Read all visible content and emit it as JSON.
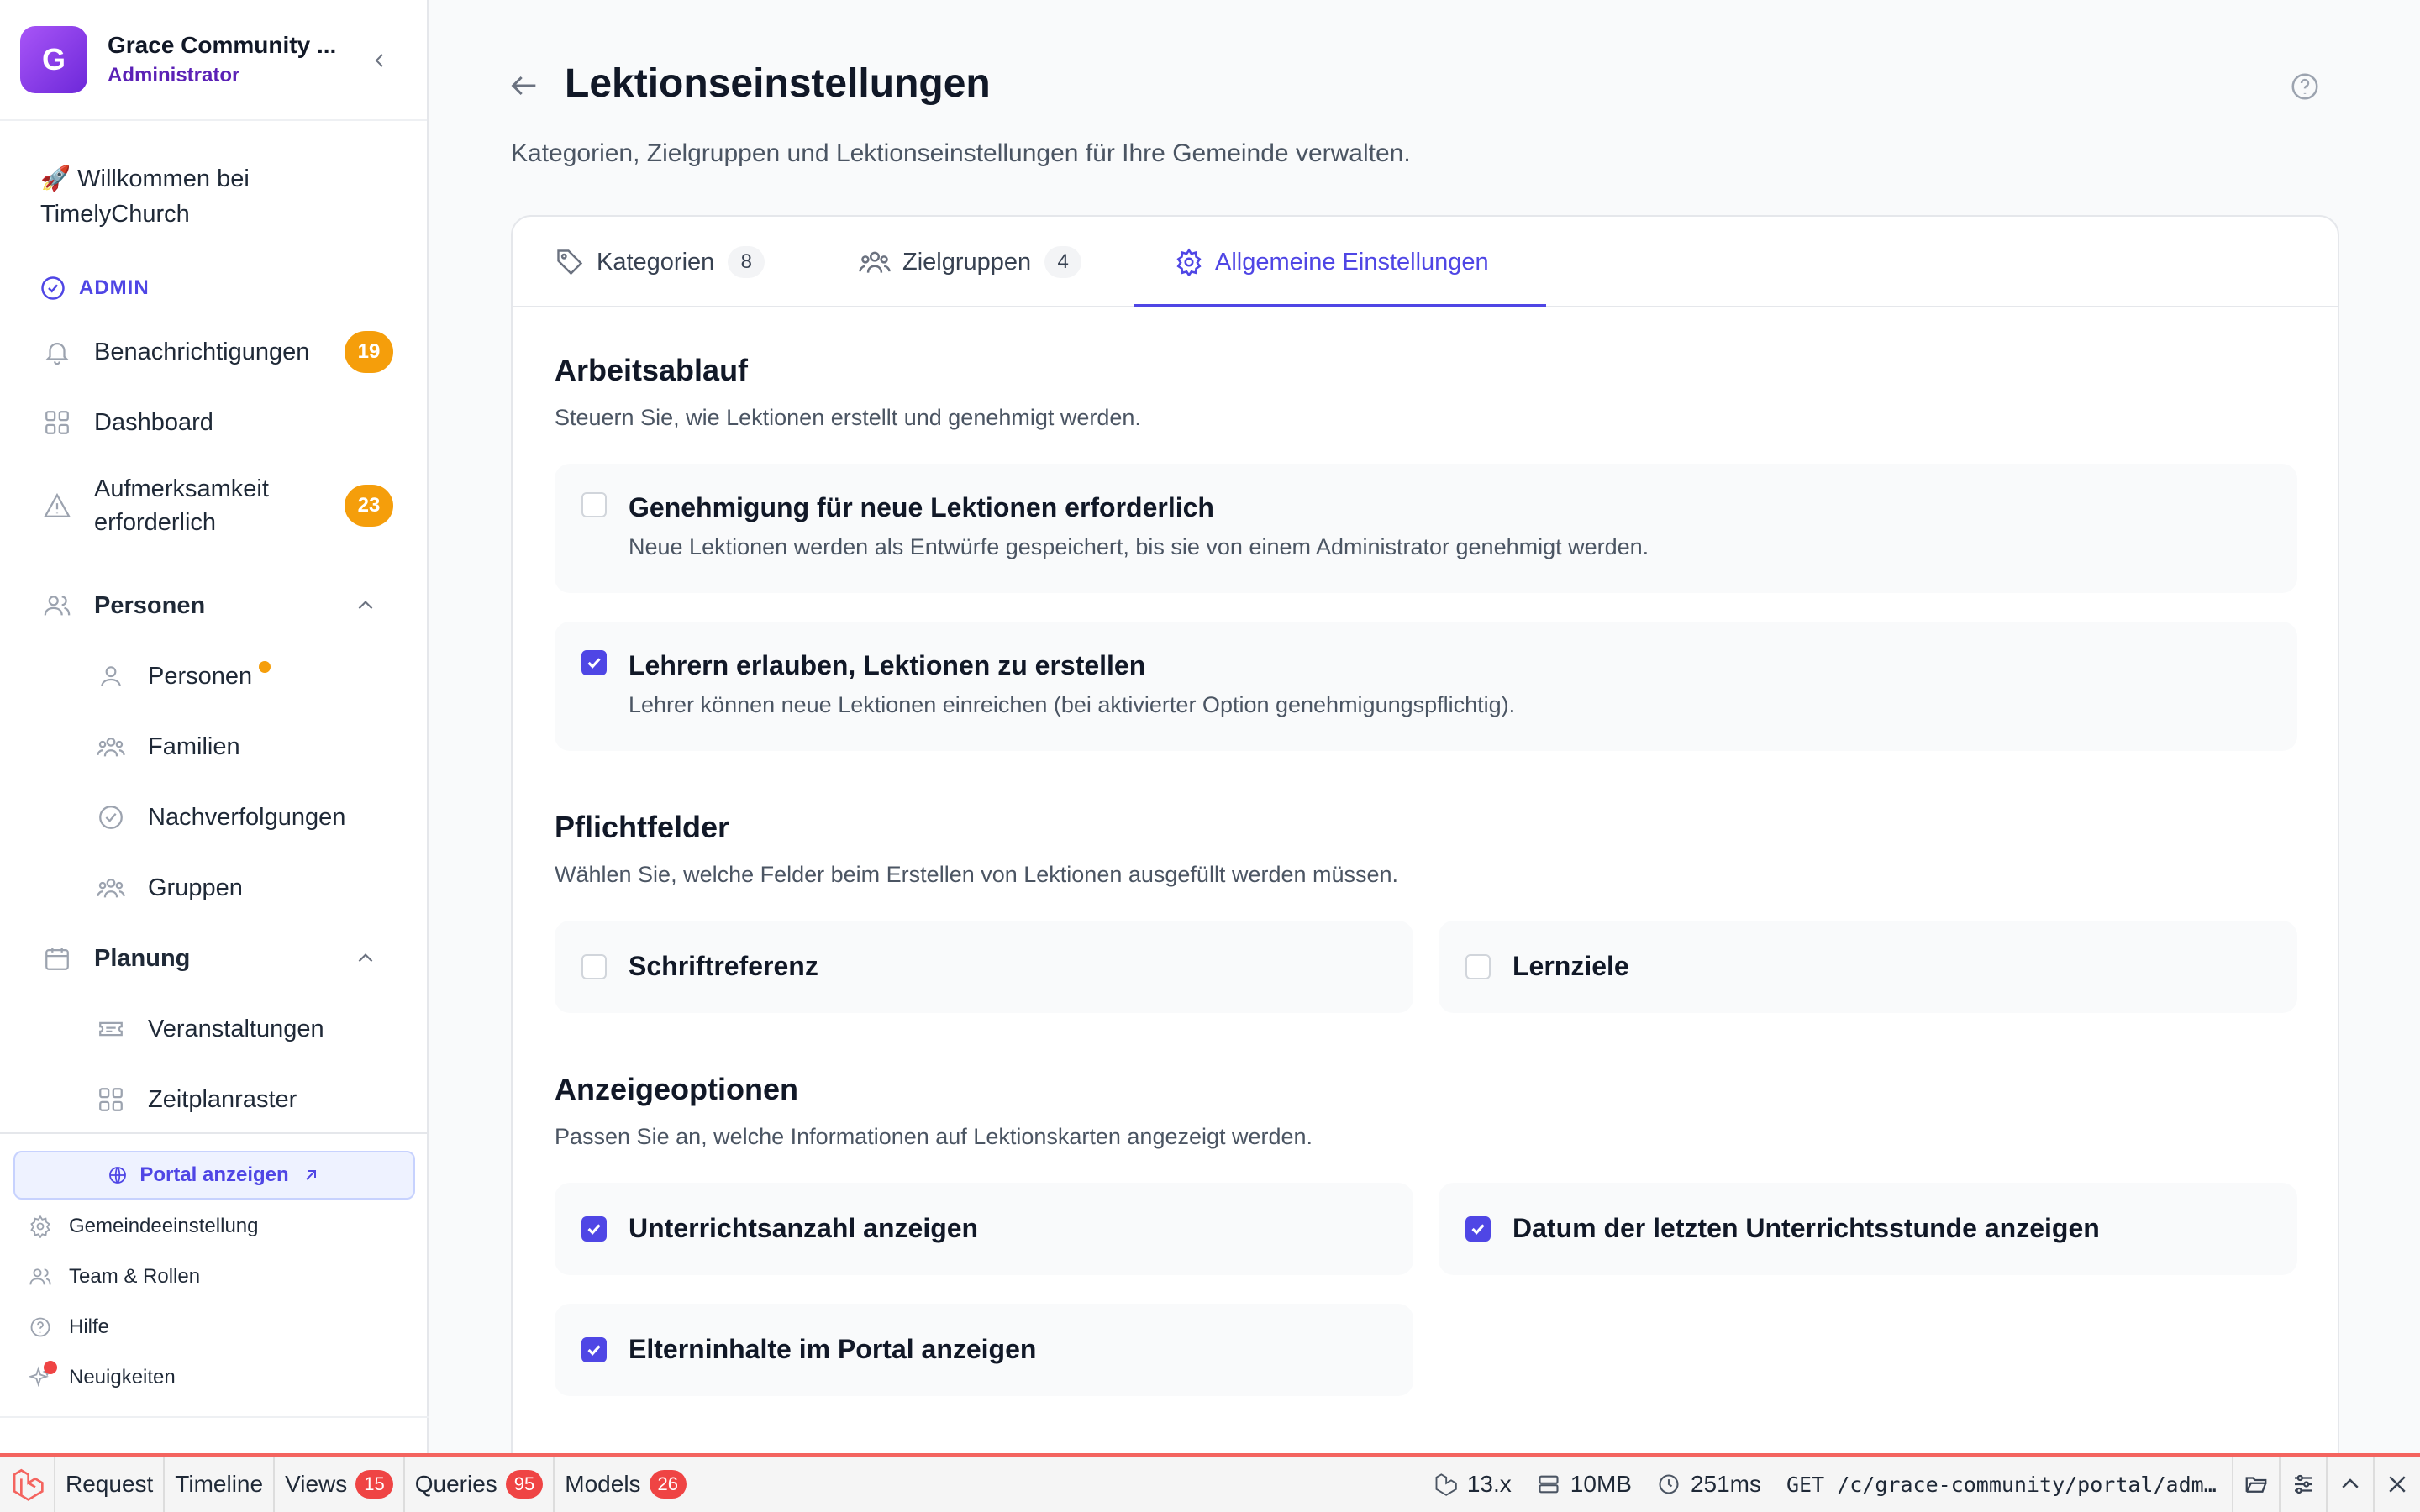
{
  "org": {
    "avatar_letter": "G",
    "name": "Grace Community ...",
    "role": "Administrator"
  },
  "sidebar": {
    "welcome": "🚀 Willkommen bei TimelyChurch",
    "admin_label": "ADMIN",
    "items": [
      {
        "label": "Benachrichtigungen",
        "badge": "19"
      },
      {
        "label": "Dashboard"
      },
      {
        "label": "Aufmerksamkeit erforderlich",
        "badge": "23"
      }
    ],
    "personen": {
      "label": "Personen",
      "children": [
        "Personen",
        "Familien",
        "Nachverfolgungen",
        "Gruppen"
      ]
    },
    "planung": {
      "label": "Planung",
      "children": [
        "Veranstaltungen",
        "Zeitplanraster"
      ]
    },
    "portal_button": "Portal anzeigen",
    "footer": [
      "Gemeindeeinstellung",
      "Team & Rollen",
      "Hilfe",
      "Neuigkeiten"
    ]
  },
  "page": {
    "title": "Lektionseinstellungen",
    "subtitle": "Kategorien, Zielgruppen und Lektionseinstellungen für Ihre Gemeinde verwalten."
  },
  "tabs": [
    {
      "label": "Kategorien",
      "count": "8"
    },
    {
      "label": "Zielgruppen",
      "count": "4"
    },
    {
      "label": "Allgemeine Einstellungen"
    }
  ],
  "sections": {
    "workflow": {
      "title": "Arbeitsablauf",
      "desc": "Steuern Sie, wie Lektionen erstellt und genehmigt werden.",
      "options": [
        {
          "title": "Genehmigung für neue Lektionen erforderlich",
          "desc": "Neue Lektionen werden als Entwürfe gespeichert, bis sie von einem Administrator genehmigt werden.",
          "checked": false
        },
        {
          "title": "Lehrern erlauben, Lektionen zu erstellen",
          "desc": "Lehrer können neue Lektionen einreichen (bei aktivierter Option genehmigungspflichtig).",
          "checked": true
        }
      ]
    },
    "required": {
      "title": "Pflichtfelder",
      "desc": "Wählen Sie, welche Felder beim Erstellen von Lektionen ausgefüllt werden müssen.",
      "options": [
        {
          "title": "Schriftreferenz",
          "checked": false
        },
        {
          "title": "Lernziele",
          "checked": false
        }
      ]
    },
    "display": {
      "title": "Anzeigeoptionen",
      "desc": "Passen Sie an, welche Informationen auf Lektionskarten angezeigt werden.",
      "options": [
        {
          "title": "Unterrichtsanzahl anzeigen",
          "checked": true
        },
        {
          "title": "Datum der letzten Unterrichtsstunde anzeigen",
          "checked": true
        },
        {
          "title": "Elterninhalte im Portal anzeigen",
          "checked": true
        }
      ]
    }
  },
  "debugbar": {
    "tabs": [
      {
        "label": "Request"
      },
      {
        "label": "Timeline"
      },
      {
        "label": "Views",
        "count": "15"
      },
      {
        "label": "Queries",
        "count": "95"
      },
      {
        "label": "Models",
        "count": "26"
      }
    ],
    "version": "13.x",
    "memory": "10MB",
    "time": "251ms",
    "route": "GET /c/grace-community/portal/adm..."
  },
  "colors": {
    "accent": "#4f46e5",
    "badge": "#f59e0b",
    "debug_red": "#ef4444"
  }
}
